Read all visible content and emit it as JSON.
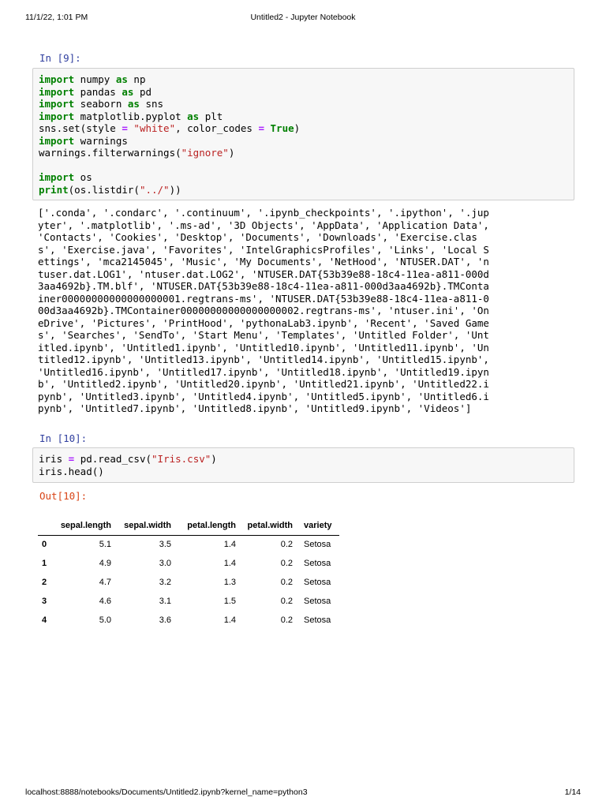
{
  "print_header": {
    "date": "11/1/22, 1:01 PM",
    "title": "Untitled2 - Jupyter Notebook"
  },
  "print_footer": {
    "url": "localhost:8888/notebooks/Documents/Untitled2.ipynb?kernel_name=python3",
    "page": "1/14"
  },
  "cell_9": {
    "prompt": "In [9]:",
    "code_lines": [
      "import numpy as np",
      "import pandas as pd",
      "import seaborn as sns",
      "import matplotlib.pyplot as plt",
      "sns.set(style = \"white\", color_codes = True)",
      "import warnings",
      "warnings.filterwarnings(\"ignore\")",
      "",
      "import os",
      "print(os.listdir(\"../\"))"
    ],
    "output_lines": [
      "['.conda', '.condarc', '.continuum', '.ipynb_checkpoints', '.ipython', '.jup",
      "yter', '.matplotlib', '.ms-ad', '3D Objects', 'AppData', 'Application Data',",
      "'Contacts', 'Cookies', 'Desktop', 'Documents', 'Downloads', 'Exercise.clas",
      "s', 'Exercise.java', 'Favorites', 'IntelGraphicsProfiles', 'Links', 'Local S",
      "ettings', 'mca2145045', 'Music', 'My Documents', 'NetHood', 'NTUSER.DAT', 'n",
      "tuser.dat.LOG1', 'ntuser.dat.LOG2', 'NTUSER.DAT{53b39e88-18c4-11ea-a811-000d",
      "3aa4692b}.TM.blf', 'NTUSER.DAT{53b39e88-18c4-11ea-a811-000d3aa4692b}.TMConta",
      "iner00000000000000000001.regtrans-ms', 'NTUSER.DAT{53b39e88-18c4-11ea-a811-0",
      "00d3aa4692b}.TMContainer00000000000000000002.regtrans-ms', 'ntuser.ini', 'On",
      "eDrive', 'Pictures', 'PrintHood', 'pythonaLab3.ipynb', 'Recent', 'Saved Game",
      "s', 'Searches', 'SendTo', 'Start Menu', 'Templates', 'Untitled Folder', 'Unt",
      "itled.ipynb', 'Untitled1.ipynb', 'Untitled10.ipynb', 'Untitled11.ipynb', 'Un",
      "titled12.ipynb', 'Untitled13.ipynb', 'Untitled14.ipynb', 'Untitled15.ipynb',",
      "'Untitled16.ipynb', 'Untitled17.ipynb', 'Untitled18.ipynb', 'Untitled19.ipyn",
      "b', 'Untitled2.ipynb', 'Untitled20.ipynb', 'Untitled21.ipynb', 'Untitled22.i",
      "pynb', 'Untitled3.ipynb', 'Untitled4.ipynb', 'Untitled5.ipynb', 'Untitled6.i",
      "pynb', 'Untitled7.ipynb', 'Untitled8.ipynb', 'Untitled9.ipynb', 'Videos']"
    ]
  },
  "cell_10": {
    "prompt": "In [10]:",
    "code_lines": [
      "iris = pd.read_csv(\"Iris.csv\")",
      "iris.head()"
    ],
    "out_prompt": "Out[10]:",
    "table": {
      "columns": [
        "",
        "sepal.length",
        "sepal.width",
        "petal.length",
        "petal.width",
        "variety"
      ],
      "rows": [
        [
          "0",
          "5.1",
          "3.5",
          "1.4",
          "0.2",
          "Setosa"
        ],
        [
          "1",
          "4.9",
          "3.0",
          "1.4",
          "0.2",
          "Setosa"
        ],
        [
          "2",
          "4.7",
          "3.2",
          "1.3",
          "0.2",
          "Setosa"
        ],
        [
          "3",
          "4.6",
          "3.1",
          "1.5",
          "0.2",
          "Setosa"
        ],
        [
          "4",
          "5.0",
          "3.6",
          "1.4",
          "0.2",
          "Setosa"
        ]
      ]
    }
  },
  "syntax_colors": {
    "keyword": "#008000",
    "string": "#ba2121",
    "operator": "#aa22ff",
    "in_prompt": "#303f9f",
    "out_prompt": "#d84315"
  }
}
